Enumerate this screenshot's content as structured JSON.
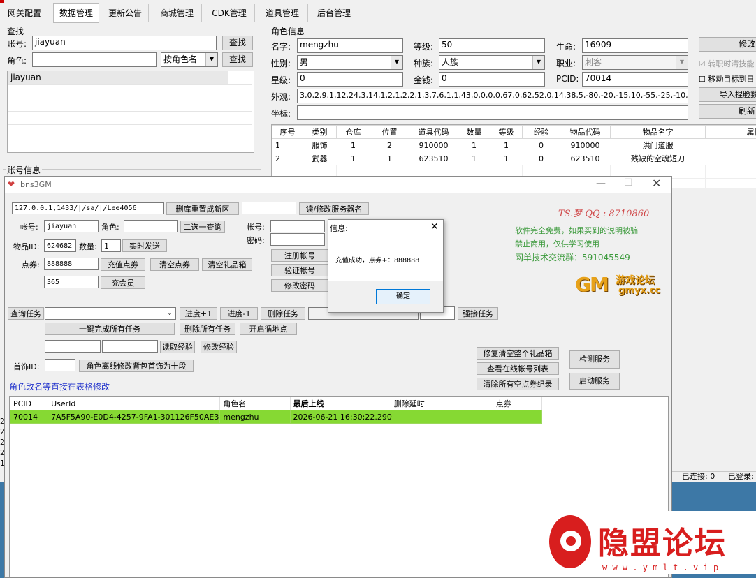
{
  "main": {
    "tabs": [
      "网关配置",
      "数据管理",
      "更新公告",
      "商城管理",
      "CDK管理",
      "道具管理",
      "后台管理"
    ],
    "search": {
      "group_title": "查找",
      "account_label": "账号:",
      "account_value": "jiayuan",
      "role_label": "角色:",
      "role_value": "",
      "role_mode": "按角色名",
      "find_btn": "查找",
      "list_items": [
        "jiayuan"
      ]
    },
    "account_group_title": "账号信息",
    "char": {
      "group_title": "角色信息",
      "name_label": "名字:",
      "name": "mengzhu",
      "level_label": "等级:",
      "level": "50",
      "hp_label": "生命:",
      "hp": "16909",
      "gender_label": "性别:",
      "gender": "男",
      "race_label": "种族:",
      "race": "人族",
      "job_label": "职业:",
      "job": "刺客",
      "star_label": "星级:",
      "star": "0",
      "gold_label": "金钱:",
      "gold": "0",
      "pcid_label": "PCID:",
      "pcid": "70014",
      "look_label": "外观:",
      "look": "3,0,2,9,1,12,24,3,14,1,2,1,2,2,1,3,7,6,1,1,43,0,0,0,0,67,0,62,52,0,14,38,5,-80,-20,-15,10,-55,-25,-10,0",
      "pos_label": "坐标:",
      "pos": "",
      "modify_btn": "修改",
      "opt1": "转职时清技能",
      "opt2": "移动目标到日",
      "import_btn": "导入捏脸数",
      "refresh_btn": "刷新"
    },
    "items_table": {
      "headers": [
        "序号",
        "类别",
        "仓库",
        "位置",
        "道具代码",
        "数量",
        "等级",
        "经验",
        "物品代码",
        "物品名字",
        "属性"
      ],
      "rows": [
        [
          "1",
          "服饰",
          "1",
          "2",
          "910000",
          "1",
          "1",
          "0",
          "910000",
          "洪门道服",
          ""
        ],
        [
          "2",
          "武器",
          "1",
          "1",
          "623510",
          "1",
          "1",
          "0",
          "623510",
          "残缺的空魂短刀",
          ""
        ]
      ]
    },
    "log_lines": [
      "2",
      "2",
      "2",
      "2",
      "1"
    ],
    "status": {
      "connected": "已连接: 0",
      "logged": "已登录:"
    }
  },
  "gm": {
    "title": "bns3GM",
    "conn": "127.0.0.1,1433/|/sa/|/Lee4056",
    "delete_reset_btn": "删库重置成新区",
    "server_name": "",
    "read_server_btn": "读/修改服务器名",
    "acct_label": "帐号:",
    "acct": "jiayuan",
    "role_label": "角色:",
    "role": "",
    "pick_btn": "二选一查询",
    "item_id_label": "物品ID:",
    "item_id": "624682",
    "qty_label": "数量:",
    "qty": "1",
    "send_btn": "实时发送",
    "points_label": "点券:",
    "points": "888888",
    "recharge_btn": "充值点券",
    "clear_points_btn": "清空点券",
    "clear_gift_btn": "清空礼品箱",
    "vip_value": "365",
    "vip_btn": "充会员",
    "acct2_label": "帐号:",
    "pwd_label": "密码:",
    "register_btn": "注册帐号",
    "verify_btn": "验证帐号",
    "change_pwd_btn": "修改密码",
    "credit": "TS.梦 QQ : 8710860",
    "notice1": "软件完全免费，如果买到的说明被骗",
    "notice2": "禁止商用，仅供学习使用",
    "notice3": "网单技术交流群：591045549",
    "logo_gm": "GM",
    "logo_text": "游戏论坛",
    "logo_url": "gmyx.cc",
    "quest_query_btn": "查询任务",
    "progress_plus": "进度+1",
    "progress_minus": "进度-1",
    "delete_quest_btn": "删除任务",
    "force_quest_btn": "强接任务",
    "complete_all_btn": "一键完成所有任务",
    "delete_all_btn": "删除所有任务",
    "open_portal_btn": "开启循地点",
    "read_exp_btn": "读取经验",
    "modify_exp_btn": "修改经验",
    "accessory_label": "首饰ID:",
    "accessory_btn": "角色离线修改背包首饰为十段",
    "repair_gift_btn": "修复清空整个礼品箱",
    "online_list_btn": "查看在线帐号列表",
    "clear_points_log_btn": "清除所有空点券纪录",
    "check_service_btn": "检测服务",
    "start_service_btn": "启动服务",
    "rename_hint": "角色改名等直接在表格修改",
    "table": {
      "headers": [
        "PCID",
        "UserId",
        "角色名",
        "最后上线",
        "删除延时",
        "点券"
      ],
      "rows": [
        [
          "70014",
          "7A5F5A90-E0D4-4257-9FA1-301126F50AE3",
          "mengzhu",
          "2026-06-21 16:30:22.290",
          "",
          ""
        ]
      ]
    }
  },
  "dialog": {
    "title": "信息:",
    "message": "充值成功，点券+：888888",
    "ok": "确定"
  },
  "watermark": {
    "text": "隐盟论坛",
    "url": "w w w . y m l t . v i p"
  },
  "colors": {
    "highlight_row": "#86d933",
    "link_blue": "#2233cc",
    "watermark_red": "#d81e1e"
  }
}
